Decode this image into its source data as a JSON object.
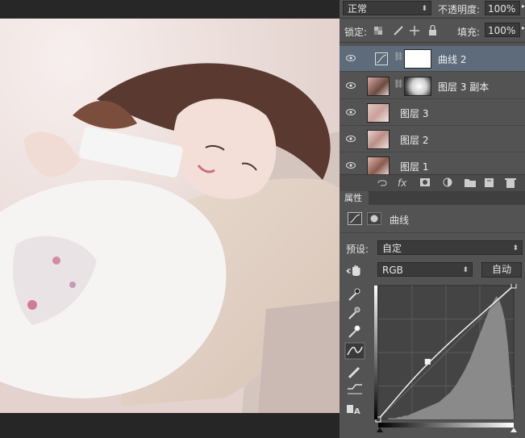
{
  "layers_toolbar": {
    "blend_mode": "正常",
    "opacity_label": "不透明度:",
    "opacity_value": "100%",
    "lock_label": "锁定:",
    "fill_label": "填充:",
    "fill_value": "100%"
  },
  "layers": [
    {
      "name": "曲线 2",
      "selected": true
    },
    {
      "name": "图层 3 副本",
      "selected": false
    },
    {
      "name": "图层 3",
      "selected": false
    },
    {
      "name": "图层 2",
      "selected": false
    },
    {
      "name": "图层 1",
      "selected": false
    }
  ],
  "layers_footer_icons": [
    "link-icon",
    "fx-icon",
    "mask-icon",
    "adjustment-icon",
    "folder-icon",
    "new-layer-icon",
    "trash-icon"
  ],
  "properties": {
    "tab_label": "属性",
    "title": "曲线",
    "preset_label": "预设:",
    "preset_value": "自定",
    "channel_value": "RGB",
    "auto_button": "自动"
  },
  "curve": {
    "input_range": [
      0,
      255
    ],
    "output_range": [
      0,
      255
    ],
    "points": [
      [
        0,
        0
      ],
      [
        93,
        110
      ],
      [
        255,
        255
      ]
    ]
  },
  "colors": {
    "panel_bg": "#535353",
    "selected_layer": "#5e6b7a",
    "dark_bg": "#262626"
  }
}
